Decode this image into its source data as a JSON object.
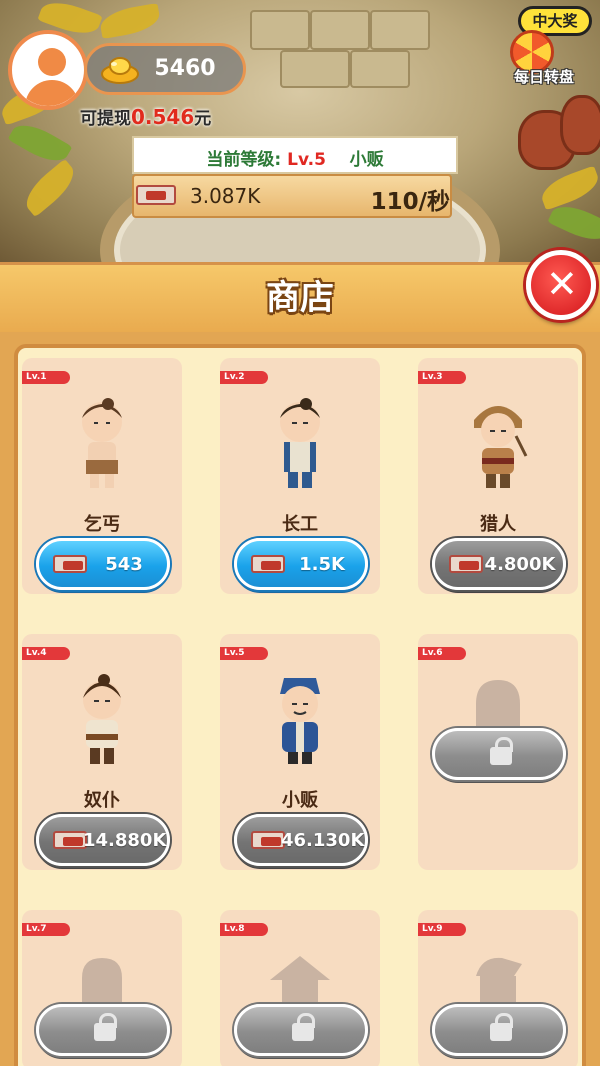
{
  "hud": {
    "coins": "5460",
    "withdraw_label": "可提现",
    "withdraw_amount": "0.546",
    "withdraw_unit": "元",
    "prize_badge": "中大奖",
    "daily_spin_label": "每日转盘",
    "level_label": "当前等级:",
    "level_value": "Lv.5",
    "level_title": "小贩",
    "income_total": "3.087K",
    "income_rate": "110/秒"
  },
  "shop": {
    "title": "商店",
    "items": [
      {
        "level": "Lv.1",
        "name": "乞丐",
        "price": "543",
        "state": "buyable"
      },
      {
        "level": "Lv.2",
        "name": "长工",
        "price": "1.5K",
        "state": "buyable"
      },
      {
        "level": "Lv.3",
        "name": "猎人",
        "price": "4.800K",
        "state": "unaffordable"
      },
      {
        "level": "Lv.4",
        "name": "奴仆",
        "price": "14.880K",
        "state": "unaffordable"
      },
      {
        "level": "Lv.5",
        "name": "小贩",
        "price": "46.130K",
        "state": "unaffordable"
      },
      {
        "level": "Lv.6",
        "name": "",
        "price": "",
        "state": "locked"
      },
      {
        "level": "Lv.7",
        "name": "",
        "price": "",
        "state": "locked"
      },
      {
        "level": "Lv.8",
        "name": "",
        "price": "",
        "state": "locked"
      },
      {
        "level": "Lv.9",
        "name": "",
        "price": "",
        "state": "locked"
      }
    ]
  },
  "colors": {
    "panel_orange": "#e9ab4f",
    "grid_bg": "#fcefc5",
    "card_bg": "#f7dcc1",
    "buy_blue": "#1aa2ea",
    "level_green": "#2d7a37",
    "level_red": "#e02822",
    "close_red": "#d3161b"
  },
  "icons": [
    "avatar-icon",
    "gold-ingot-icon",
    "lucky-wheel-icon",
    "cash-icon",
    "close-icon",
    "lock-icon"
  ]
}
